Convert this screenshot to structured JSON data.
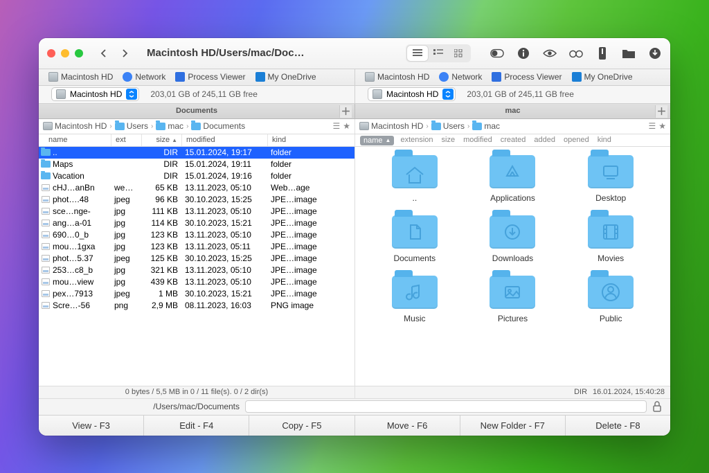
{
  "window": {
    "title": "Macintosh HD/Users/mac/Docu..."
  },
  "favorites": [
    {
      "label": "Macintosh HD",
      "icon": "hd"
    },
    {
      "label": "Network",
      "icon": "net"
    },
    {
      "label": "Process Viewer",
      "icon": "pv"
    },
    {
      "label": "My OneDrive",
      "icon": "od"
    }
  ],
  "drive": {
    "name": "Macintosh HD",
    "free": "203,01 GB of 245,11 GB free"
  },
  "left": {
    "title": "Documents",
    "crumbs": [
      "Macintosh HD",
      "Users",
      "mac",
      "Documents"
    ],
    "cols": {
      "name": "name",
      "ext": "ext",
      "size": "size",
      "modified": "modified",
      "kind": "kind"
    },
    "files": [
      {
        "icon": "folder",
        "name": "..",
        "ext": "",
        "size": "DIR",
        "modified": "15.01.2024, 19:17",
        "kind": "folder",
        "sel": true
      },
      {
        "icon": "folder",
        "name": "Maps",
        "ext": "",
        "size": "DIR",
        "modified": "15.01.2024, 19:11",
        "kind": "folder"
      },
      {
        "icon": "folder",
        "name": "Vacation",
        "ext": "",
        "size": "DIR",
        "modified": "15.01.2024, 19:16",
        "kind": "folder"
      },
      {
        "icon": "img",
        "name": "cHJ…anBn",
        "ext": "we…",
        "size": "65 KB",
        "modified": "13.11.2023, 05:10",
        "kind": "Web…age"
      },
      {
        "icon": "img",
        "name": "phot….48",
        "ext": "jpeg",
        "size": "96 KB",
        "modified": "30.10.2023, 15:25",
        "kind": "JPE…image"
      },
      {
        "icon": "img",
        "name": "sce…nge-",
        "ext": "jpg",
        "size": "111 KB",
        "modified": "13.11.2023, 05:10",
        "kind": "JPE…image"
      },
      {
        "icon": "img",
        "name": "ang…a-01",
        "ext": "jpg",
        "size": "114 KB",
        "modified": "30.10.2023, 15:21",
        "kind": "JPE…image"
      },
      {
        "icon": "img",
        "name": "690…0_b",
        "ext": "jpg",
        "size": "123 KB",
        "modified": "13.11.2023, 05:10",
        "kind": "JPE…image"
      },
      {
        "icon": "img",
        "name": "mou…1gxa",
        "ext": "jpg",
        "size": "123 KB",
        "modified": "13.11.2023, 05:11",
        "kind": "JPE…image"
      },
      {
        "icon": "img",
        "name": "phot…5.37",
        "ext": "jpeg",
        "size": "125 KB",
        "modified": "30.10.2023, 15:25",
        "kind": "JPE…image"
      },
      {
        "icon": "img",
        "name": "253…c8_b",
        "ext": "jpg",
        "size": "321 KB",
        "modified": "13.11.2023, 05:10",
        "kind": "JPE…image"
      },
      {
        "icon": "img",
        "name": "mou…view",
        "ext": "jpg",
        "size": "439 KB",
        "modified": "13.11.2023, 05:10",
        "kind": "JPE…image"
      },
      {
        "icon": "img",
        "name": "pex…7913",
        "ext": "jpeg",
        "size": "1 MB",
        "modified": "30.10.2023, 15:21",
        "kind": "JPE…image"
      },
      {
        "icon": "img",
        "name": "Scre…-56",
        "ext": "png",
        "size": "2,9 MB",
        "modified": "08.11.2023, 16:03",
        "kind": "PNG image"
      }
    ],
    "status": "0 bytes / 5,5 MB in 0 / 11 file(s). 0 / 2 dir(s)"
  },
  "right": {
    "title": "mac",
    "crumbs": [
      "Macintosh HD",
      "Users",
      "mac"
    ],
    "cols": [
      "name",
      "extension",
      "size",
      "modified",
      "created",
      "added",
      "opened",
      "kind"
    ],
    "items": [
      {
        "label": "..",
        "icon": "home"
      },
      {
        "label": "Applications",
        "icon": "apps"
      },
      {
        "label": "Desktop",
        "icon": "desktop"
      },
      {
        "label": "Documents",
        "icon": "doc"
      },
      {
        "label": "Downloads",
        "icon": "down"
      },
      {
        "label": "Movies",
        "icon": "movie"
      },
      {
        "label": "Music",
        "icon": "music"
      },
      {
        "label": "Pictures",
        "icon": "pic"
      },
      {
        "label": "Public",
        "icon": "public"
      }
    ],
    "status": {
      "dir": "DIR",
      "date": "16.01.2024, 15:40:28"
    }
  },
  "pathbar": {
    "label": "/Users/mac/Documents"
  },
  "buttons": [
    "View - F3",
    "Edit - F4",
    "Copy - F5",
    "Move - F6",
    "New Folder - F7",
    "Delete - F8"
  ]
}
